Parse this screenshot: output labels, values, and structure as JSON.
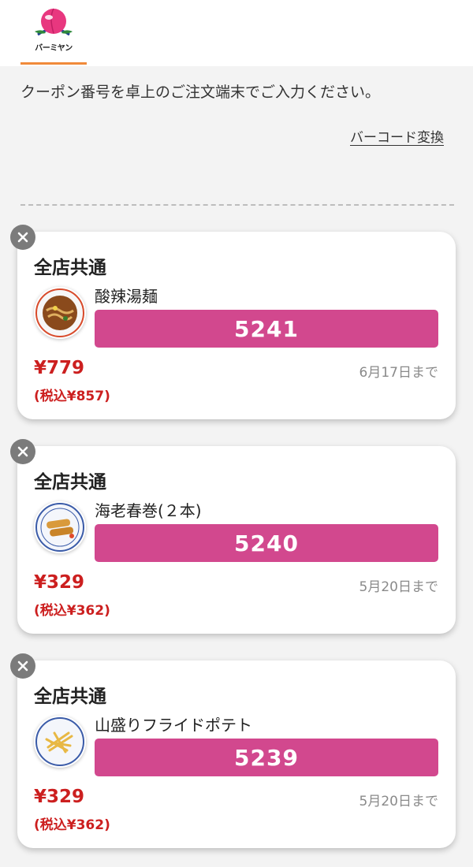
{
  "header": {
    "logo_text": "バーミヤン",
    "colors": {
      "logo_peach": "#e8377f",
      "tab_underline": "#f08a3a"
    }
  },
  "instruction": "クーポン番号を卓上のご注文端末でご入力ください。",
  "barcode_link": "バーコード変換",
  "accent_color": "#d2488e",
  "coupons": [
    {
      "scope": "全店共通",
      "name": "酸辣湯麺",
      "code": "5241",
      "price": "¥779",
      "price_tax": "(税込¥857)",
      "expiry": "6月17日まで",
      "image_icon": "soup-noodle-dish-icon"
    },
    {
      "scope": "全店共通",
      "name": "海老春巻(２本)",
      "code": "5240",
      "price": "¥329",
      "price_tax": "(税込¥362)",
      "expiry": "5月20日まで",
      "image_icon": "spring-roll-dish-icon"
    },
    {
      "scope": "全店共通",
      "name": "山盛りフライドポテト",
      "code": "5239",
      "price": "¥329",
      "price_tax": "(税込¥362)",
      "expiry": "5月20日まで",
      "image_icon": "french-fries-dish-icon"
    }
  ]
}
